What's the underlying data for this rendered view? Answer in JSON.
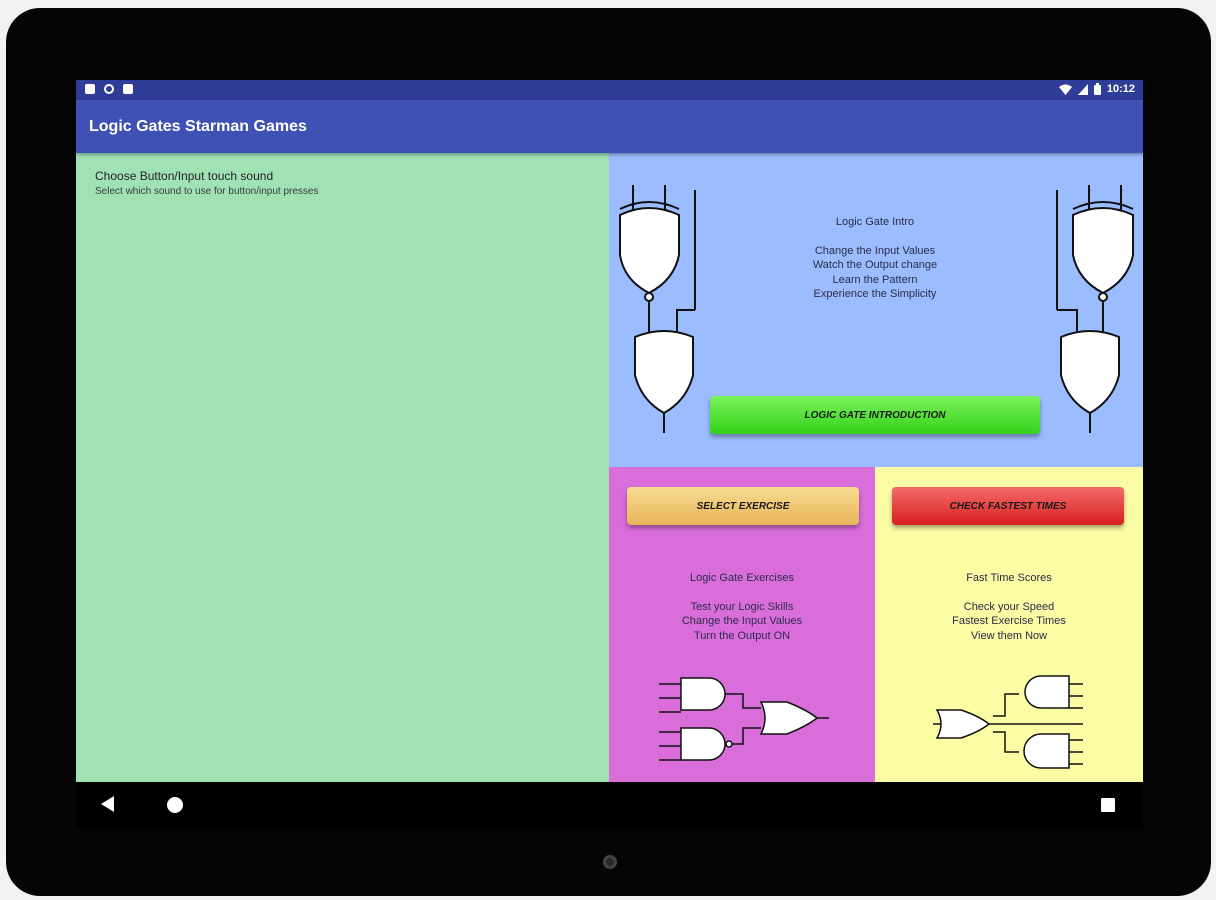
{
  "status_bar": {
    "time": "10:12"
  },
  "app_bar": {
    "title": "Logic Gates Starman Games"
  },
  "settings": {
    "title": "Choose Button/Input touch sound",
    "subtitle": "Select which sound to use for button/input presses"
  },
  "intro": {
    "title": "Logic Gate Intro",
    "lines": [
      "Change the Input Values",
      "Watch the Output change",
      "Learn the Pattern",
      "Experience the Simplicity"
    ],
    "button_label": "LOGIC GATE INTRODUCTION"
  },
  "exercises": {
    "button_label": "SELECT EXERCISE",
    "title": "Logic Gate Exercises",
    "lines": [
      "Test your Logic Skills",
      "Change the Input Values",
      "Turn the Output ON"
    ]
  },
  "times": {
    "button_label": "CHECK FASTEST TIMES",
    "title": "Fast Time Scores",
    "lines": [
      "Check your Speed",
      "Fastest Exercise Times",
      "View them Now"
    ]
  },
  "colors": {
    "status_bar": "#2f3c98",
    "app_bar": "#3f51b5",
    "settings_panel": "#a1e2b4",
    "intro_panel": "#9bbcff",
    "exercise_panel": "#d96dd9",
    "times_panel": "#fcfca4",
    "intro_button": "#4fe132",
    "exercise_button": "#f0c874",
    "times_button": "#e63b3b"
  },
  "icons": {
    "status_left": [
      "notification-icon",
      "sync-icon",
      "sd-card-icon"
    ],
    "status_right": [
      "wifi-icon",
      "signal-icon",
      "battery-icon"
    ],
    "nav": [
      "back-icon",
      "home-icon",
      "recents-icon"
    ]
  }
}
